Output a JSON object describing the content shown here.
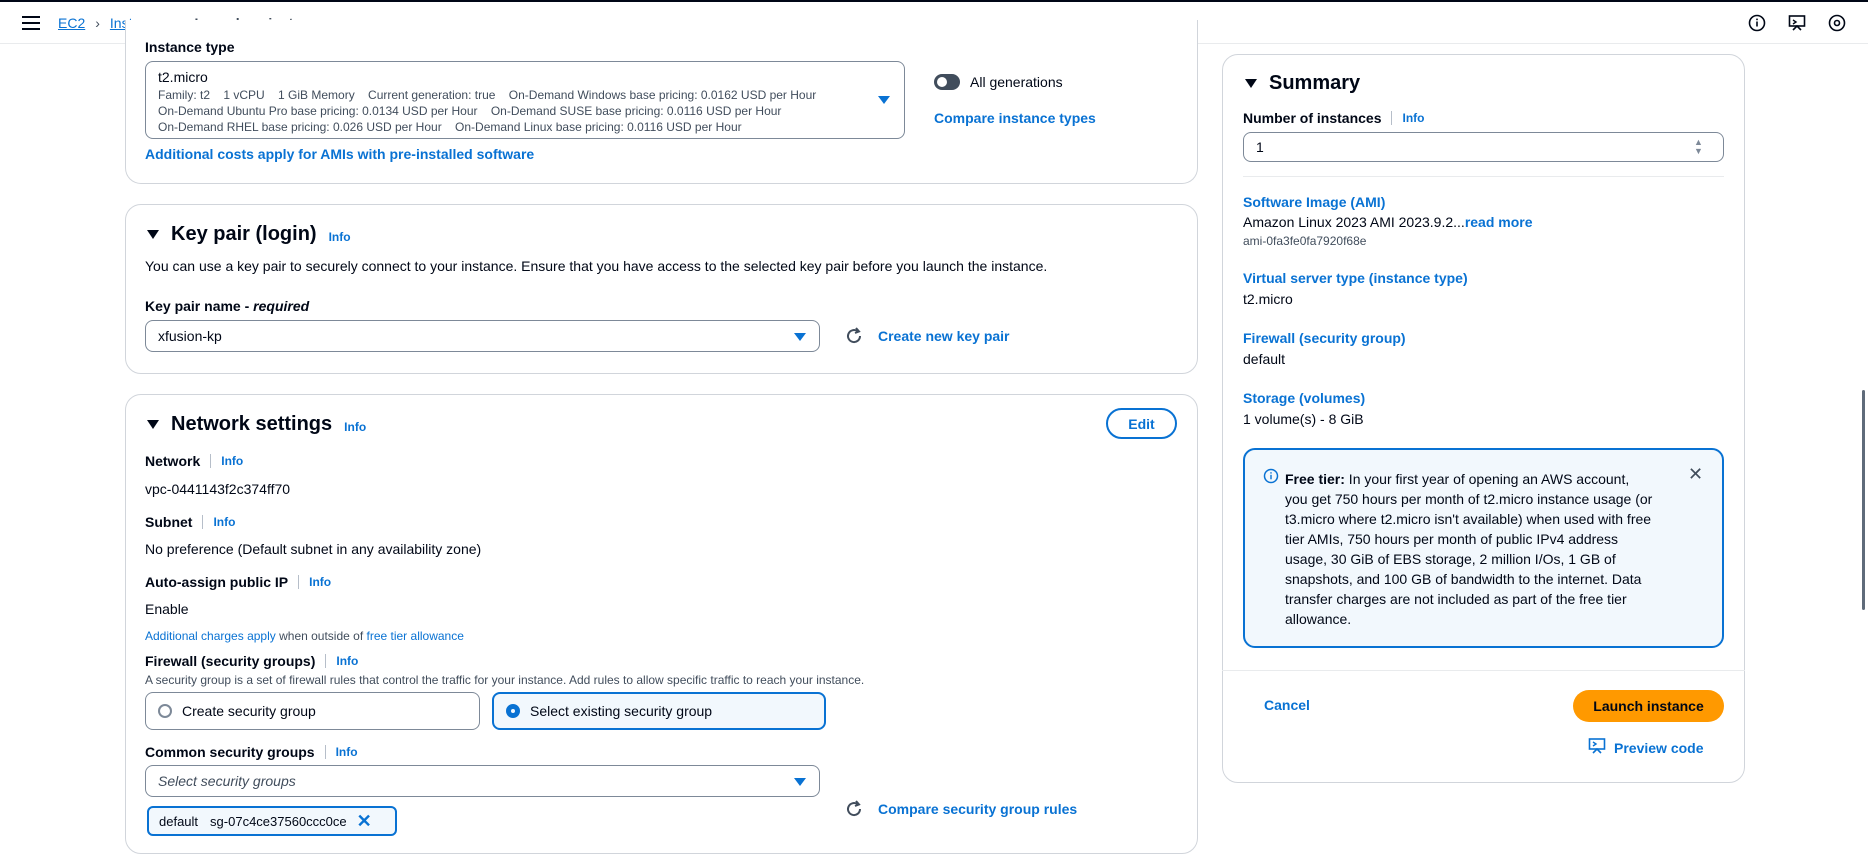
{
  "breadcrumb": {
    "root": "EC2",
    "parent": "Instances",
    "current": "Launch an instance"
  },
  "instance_type": {
    "label": "Instance type",
    "name": "t2.micro",
    "line1": "Family: t2    1 vCPU    1 GiB Memory    Current generation: true    On-Demand Windows base pricing: 0.0162 USD per Hour",
    "line2": "On-Demand Ubuntu Pro base pricing: 0.0134 USD per Hour    On-Demand SUSE base pricing: 0.0116 USD per Hour",
    "line3": "On-Demand RHEL base pricing: 0.026 USD per Hour    On-Demand Linux base pricing: 0.0116 USD per Hour",
    "additional_costs": "Additional costs apply for AMIs with pre-installed software",
    "all_generations": "All generations",
    "compare": "Compare instance types"
  },
  "key_pair": {
    "title": "Key pair (login)",
    "info": "Info",
    "description": "You can use a key pair to securely connect to your instance. Ensure that you have access to the selected key pair before you launch the instance.",
    "name_label": "Key pair name - ",
    "required": "required",
    "value": "xfusion-kp",
    "create": "Create new key pair"
  },
  "network": {
    "title": "Network settings",
    "info": "Info",
    "edit": "Edit",
    "network_label": "Network",
    "network_value": "vpc-0441143f2c374ff70",
    "subnet_label": "Subnet",
    "subnet_value": "No preference (Default subnet in any availability zone)",
    "public_ip_label": "Auto-assign public IP",
    "public_ip_value": "Enable",
    "charges_link": "Additional charges apply",
    "charges_text": " when outside of ",
    "free_tier_link": "free tier allowance",
    "firewall_label": "Firewall (security groups)",
    "firewall_desc": "A security group is a set of firewall rules that control the traffic for your instance. Add rules to allow specific traffic to reach your instance.",
    "create_sg": "Create security group",
    "select_sg": "Select existing security group",
    "common_sg_label": "Common security groups",
    "sg_placeholder": "Select security groups",
    "compare_sg": "Compare security group rules",
    "token_name": "default",
    "token_id": "sg-07c4ce37560ccc0ce"
  },
  "summary": {
    "title": "Summary",
    "num_label": "Number of instances",
    "info": "Info",
    "num_value": "1",
    "ami_label": "Software Image (AMI)",
    "ami_value": "Amazon Linux 2023 AMI 2023.9.2...",
    "read_more": "read more",
    "ami_id": "ami-0fa3fe0fa7920f68e",
    "server_label": "Virtual server type (instance type)",
    "server_value": "t2.micro",
    "firewall_label": "Firewall (security group)",
    "firewall_value": "default",
    "storage_label": "Storage (volumes)",
    "storage_value": "1 volume(s) - 8 GiB",
    "free_tier_bold": "Free tier:",
    "free_tier_text": " In your first year of opening an AWS account, you get 750 hours per month of t2.micro instance usage (or t3.micro where t2.micro isn't available) when used with free tier AMIs, 750 hours per month of public IPv4 address usage, 30 GiB of EBS storage, 2 million I/Os, 1 GB of snapshots, and 100 GB of bandwidth to the internet. Data transfer charges are not included as part of the free tier allowance.",
    "cancel": "Cancel",
    "launch": "Launch instance",
    "preview": "Preview code"
  },
  "icons": {
    "menu": "menu-icon",
    "info": "info-circle-icon",
    "feedback": "feedback-icon",
    "settings": "settings-icon",
    "refresh": "refresh-icon",
    "close": "close-icon",
    "preview": "code-preview-icon"
  },
  "colors": {
    "accent": "#0972d3",
    "primary_button": "#ff9900",
    "text": "#000716"
  }
}
